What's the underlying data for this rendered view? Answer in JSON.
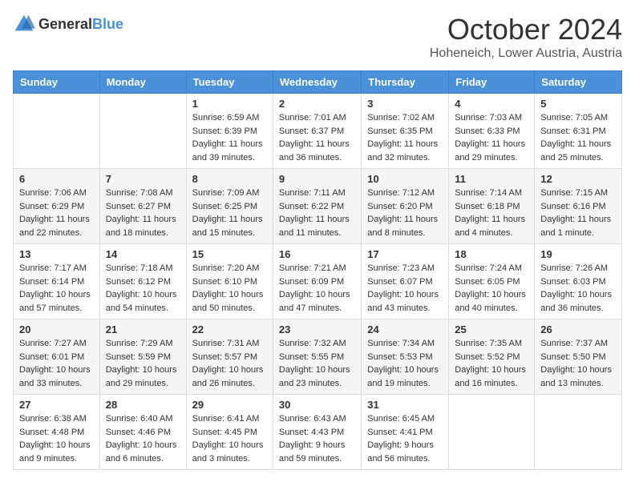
{
  "header": {
    "logo": {
      "text_general": "General",
      "text_blue": "Blue"
    },
    "month": "October 2024",
    "location": "Hoheneich, Lower Austria, Austria"
  },
  "weekdays": [
    "Sunday",
    "Monday",
    "Tuesday",
    "Wednesday",
    "Thursday",
    "Friday",
    "Saturday"
  ],
  "weeks": [
    [
      {
        "day": "",
        "info": ""
      },
      {
        "day": "",
        "info": ""
      },
      {
        "day": "1",
        "sunrise": "Sunrise: 6:59 AM",
        "sunset": "Sunset: 6:39 PM",
        "daylight": "Daylight: 11 hours and 39 minutes."
      },
      {
        "day": "2",
        "sunrise": "Sunrise: 7:01 AM",
        "sunset": "Sunset: 6:37 PM",
        "daylight": "Daylight: 11 hours and 36 minutes."
      },
      {
        "day": "3",
        "sunrise": "Sunrise: 7:02 AM",
        "sunset": "Sunset: 6:35 PM",
        "daylight": "Daylight: 11 hours and 32 minutes."
      },
      {
        "day": "4",
        "sunrise": "Sunrise: 7:03 AM",
        "sunset": "Sunset: 6:33 PM",
        "daylight": "Daylight: 11 hours and 29 minutes."
      },
      {
        "day": "5",
        "sunrise": "Sunrise: 7:05 AM",
        "sunset": "Sunset: 6:31 PM",
        "daylight": "Daylight: 11 hours and 25 minutes."
      }
    ],
    [
      {
        "day": "6",
        "sunrise": "Sunrise: 7:06 AM",
        "sunset": "Sunset: 6:29 PM",
        "daylight": "Daylight: 11 hours and 22 minutes."
      },
      {
        "day": "7",
        "sunrise": "Sunrise: 7:08 AM",
        "sunset": "Sunset: 6:27 PM",
        "daylight": "Daylight: 11 hours and 18 minutes."
      },
      {
        "day": "8",
        "sunrise": "Sunrise: 7:09 AM",
        "sunset": "Sunset: 6:25 PM",
        "daylight": "Daylight: 11 hours and 15 minutes."
      },
      {
        "day": "9",
        "sunrise": "Sunrise: 7:11 AM",
        "sunset": "Sunset: 6:22 PM",
        "daylight": "Daylight: 11 hours and 11 minutes."
      },
      {
        "day": "10",
        "sunrise": "Sunrise: 7:12 AM",
        "sunset": "Sunset: 6:20 PM",
        "daylight": "Daylight: 11 hours and 8 minutes."
      },
      {
        "day": "11",
        "sunrise": "Sunrise: 7:14 AM",
        "sunset": "Sunset: 6:18 PM",
        "daylight": "Daylight: 11 hours and 4 minutes."
      },
      {
        "day": "12",
        "sunrise": "Sunrise: 7:15 AM",
        "sunset": "Sunset: 6:16 PM",
        "daylight": "Daylight: 11 hours and 1 minute."
      }
    ],
    [
      {
        "day": "13",
        "sunrise": "Sunrise: 7:17 AM",
        "sunset": "Sunset: 6:14 PM",
        "daylight": "Daylight: 10 hours and 57 minutes."
      },
      {
        "day": "14",
        "sunrise": "Sunrise: 7:18 AM",
        "sunset": "Sunset: 6:12 PM",
        "daylight": "Daylight: 10 hours and 54 minutes."
      },
      {
        "day": "15",
        "sunrise": "Sunrise: 7:20 AM",
        "sunset": "Sunset: 6:10 PM",
        "daylight": "Daylight: 10 hours and 50 minutes."
      },
      {
        "day": "16",
        "sunrise": "Sunrise: 7:21 AM",
        "sunset": "Sunset: 6:09 PM",
        "daylight": "Daylight: 10 hours and 47 minutes."
      },
      {
        "day": "17",
        "sunrise": "Sunrise: 7:23 AM",
        "sunset": "Sunset: 6:07 PM",
        "daylight": "Daylight: 10 hours and 43 minutes."
      },
      {
        "day": "18",
        "sunrise": "Sunrise: 7:24 AM",
        "sunset": "Sunset: 6:05 PM",
        "daylight": "Daylight: 10 hours and 40 minutes."
      },
      {
        "day": "19",
        "sunrise": "Sunrise: 7:26 AM",
        "sunset": "Sunset: 6:03 PM",
        "daylight": "Daylight: 10 hours and 36 minutes."
      }
    ],
    [
      {
        "day": "20",
        "sunrise": "Sunrise: 7:27 AM",
        "sunset": "Sunset: 6:01 PM",
        "daylight": "Daylight: 10 hours and 33 minutes."
      },
      {
        "day": "21",
        "sunrise": "Sunrise: 7:29 AM",
        "sunset": "Sunset: 5:59 PM",
        "daylight": "Daylight: 10 hours and 29 minutes."
      },
      {
        "day": "22",
        "sunrise": "Sunrise: 7:31 AM",
        "sunset": "Sunset: 5:57 PM",
        "daylight": "Daylight: 10 hours and 26 minutes."
      },
      {
        "day": "23",
        "sunrise": "Sunrise: 7:32 AM",
        "sunset": "Sunset: 5:55 PM",
        "daylight": "Daylight: 10 hours and 23 minutes."
      },
      {
        "day": "24",
        "sunrise": "Sunrise: 7:34 AM",
        "sunset": "Sunset: 5:53 PM",
        "daylight": "Daylight: 10 hours and 19 minutes."
      },
      {
        "day": "25",
        "sunrise": "Sunrise: 7:35 AM",
        "sunset": "Sunset: 5:52 PM",
        "daylight": "Daylight: 10 hours and 16 minutes."
      },
      {
        "day": "26",
        "sunrise": "Sunrise: 7:37 AM",
        "sunset": "Sunset: 5:50 PM",
        "daylight": "Daylight: 10 hours and 13 minutes."
      }
    ],
    [
      {
        "day": "27",
        "sunrise": "Sunrise: 6:38 AM",
        "sunset": "Sunset: 4:48 PM",
        "daylight": "Daylight: 10 hours and 9 minutes."
      },
      {
        "day": "28",
        "sunrise": "Sunrise: 6:40 AM",
        "sunset": "Sunset: 4:46 PM",
        "daylight": "Daylight: 10 hours and 6 minutes."
      },
      {
        "day": "29",
        "sunrise": "Sunrise: 6:41 AM",
        "sunset": "Sunset: 4:45 PM",
        "daylight": "Daylight: 10 hours and 3 minutes."
      },
      {
        "day": "30",
        "sunrise": "Sunrise: 6:43 AM",
        "sunset": "Sunset: 4:43 PM",
        "daylight": "Daylight: 9 hours and 59 minutes."
      },
      {
        "day": "31",
        "sunrise": "Sunrise: 6:45 AM",
        "sunset": "Sunset: 4:41 PM",
        "daylight": "Daylight: 9 hours and 56 minutes."
      },
      {
        "day": "",
        "info": ""
      },
      {
        "day": "",
        "info": ""
      }
    ]
  ]
}
